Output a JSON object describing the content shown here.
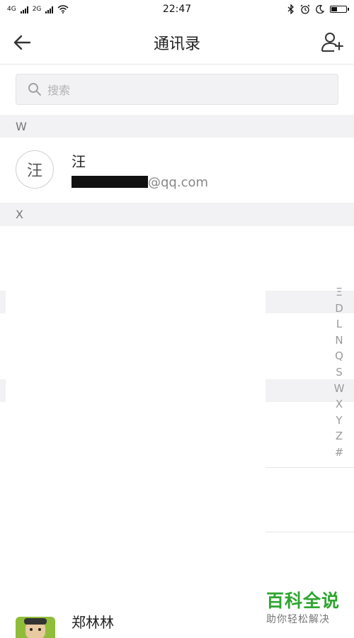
{
  "status_bar": {
    "network_1": "4G",
    "network_2": "2G",
    "time": "22:47",
    "battery_level": 0.4
  },
  "header": {
    "title": "通讯录"
  },
  "search": {
    "placeholder": "搜索"
  },
  "sections": [
    {
      "letter": "W"
    },
    {
      "letter": "X"
    }
  ],
  "contacts": [
    {
      "avatar_char": "汪",
      "name": "汪",
      "email_suffix": "@qq.com"
    }
  ],
  "index_bar": [
    "Ξ",
    "D",
    "L",
    "N",
    "Q",
    "S",
    "W",
    "X",
    "Y",
    "Z",
    "#"
  ],
  "partial_contact": {
    "name": "郑林林"
  },
  "watermark": {
    "title": "百科全说",
    "subtitle": "助你轻松解决"
  },
  "colors": {
    "accent_green": "#2ea52f",
    "section_bg": "#f2f2f4"
  }
}
